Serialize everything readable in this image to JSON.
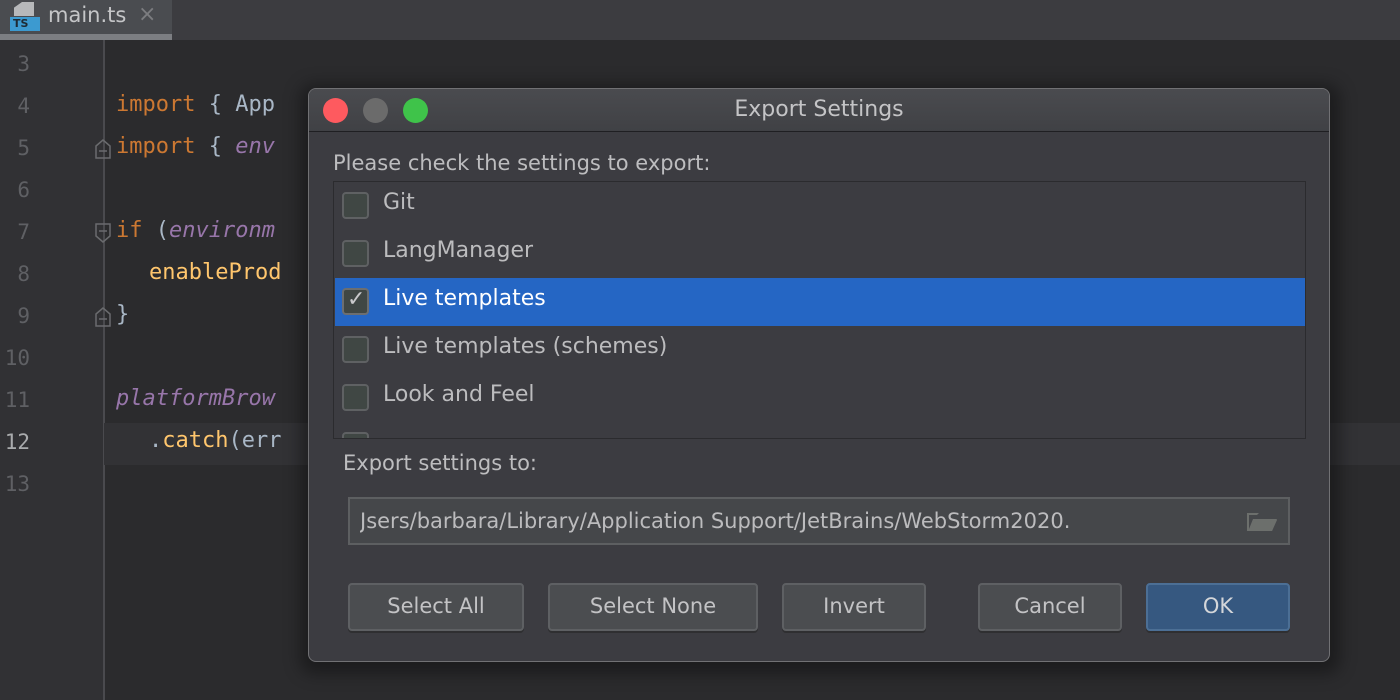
{
  "tab": {
    "file_type_badge": "TS",
    "label": "main.ts",
    "close_glyph": "×"
  },
  "editor": {
    "lines": [
      {
        "number": "3",
        "code": ""
      },
      {
        "number": "4",
        "code": "import { App"
      },
      {
        "number": "5",
        "code": "import { env"
      },
      {
        "number": "6",
        "code": ""
      },
      {
        "number": "7",
        "code": "if (environm"
      },
      {
        "number": "8",
        "code": "  enableProd"
      },
      {
        "number": "9",
        "code": "}"
      },
      {
        "number": "10",
        "code": ""
      },
      {
        "number": "11",
        "code": "platformBrow"
      },
      {
        "number": "12",
        "code": "  .catch(err"
      },
      {
        "number": "13",
        "code": ""
      }
    ],
    "current_line": "12",
    "tokens": {
      "l4_kw": "import",
      "l4_rest": " { App",
      "l5_kw": "import",
      "l5_brace": " { ",
      "l5_it": "env",
      "l7_kw": "if",
      "l7_paren": " (",
      "l7_it": "environm",
      "l8_fn": "enableProd",
      "l9_brace": "}",
      "l11_it": "platformBrow",
      "l12_dot": ".",
      "l12_fn": "catch",
      "l12_rest": "(err"
    }
  },
  "dialog": {
    "title": "Export Settings",
    "prompt": "Please check the settings to export:",
    "items": [
      {
        "label": "Git",
        "checked": false,
        "selected": false
      },
      {
        "label": "LangManager",
        "checked": false,
        "selected": false
      },
      {
        "label": "Live templates",
        "checked": true,
        "selected": true
      },
      {
        "label": "Live templates (schemes)",
        "checked": false,
        "selected": false
      },
      {
        "label": "Look and Feel",
        "checked": false,
        "selected": false
      },
      {
        "label": "",
        "checked": false,
        "selected": false,
        "clipped": true
      }
    ],
    "export_to_label": "Export settings to:",
    "export_path": "Jsers/barbara/Library/Application Support/JetBrains/WebStorm2020.",
    "buttons": {
      "select_all": "Select All",
      "select_none": "Select None",
      "invert": "Invert",
      "cancel": "Cancel",
      "ok": "OK"
    },
    "check_glyph": "✓"
  },
  "colors": {
    "selection": "#2566c4",
    "primary_button": "#365880",
    "traffic_close": "#fe5a5f",
    "traffic_minimize": "#6b6b6b",
    "traffic_maximize": "#3fc34a",
    "keyword": "#cc7832",
    "function": "#ffc66d",
    "italic_identifier": "#9876aa"
  }
}
